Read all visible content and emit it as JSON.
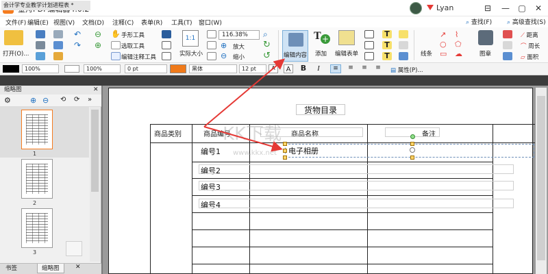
{
  "titlebar": {
    "app_title": "金舟PDF编辑器4.0.2",
    "user_name": "Lyan",
    "logo_letter": "P"
  },
  "menu": [
    "文件(F)",
    "编辑(E)",
    "视图(V)",
    "文档(D)",
    "注释(C)",
    "表单(R)",
    "工具(T)",
    "窗口(W)"
  ],
  "right_tools": {
    "search": "查找(F)",
    "advanced_search": "高级查找(S)"
  },
  "toolbar": {
    "open_label": "打开(O)...",
    "hand_tool": "手形工具",
    "select_tool": "选取工具",
    "annot_select_tool": "编辑注释工具",
    "actual_size": "实际大小",
    "zoom_value": "116.38%",
    "zoom_in": "放大",
    "zoom_out": "缩小",
    "edit_content": "编辑内容",
    "add": "添加",
    "edit_form": "编辑表单",
    "line": "线条",
    "stamp": "图章",
    "distance": "距离",
    "perimeter": "周长",
    "area": "面积"
  },
  "formatbar": {
    "opacity1": "100%",
    "opacity2": "100%",
    "line_width": "0 pt",
    "font": "黑体",
    "font_size": "12 pt",
    "properties": "属性(P)..."
  },
  "doc_tab": "会计学专业教学计划进程表 *",
  "panel": {
    "title": "缩略图",
    "thumb_nums": [
      "1",
      "2",
      "3"
    ],
    "bottom_tabs": [
      "书签",
      "缩略图"
    ]
  },
  "document": {
    "title": "货物目录",
    "headers": [
      "商品类别",
      "商品编号",
      "商品名称",
      "备注"
    ],
    "rows": [
      "编号1",
      "编号2",
      "编号3",
      "编号4"
    ],
    "edited_text": "电子相册"
  },
  "watermark": {
    "text": "KK下载",
    "url": "www.kkx.net"
  },
  "colors": {
    "accent_red": "#e53935",
    "selection_blue": "#7aaed8",
    "logo_orange": "#f57c1f"
  }
}
